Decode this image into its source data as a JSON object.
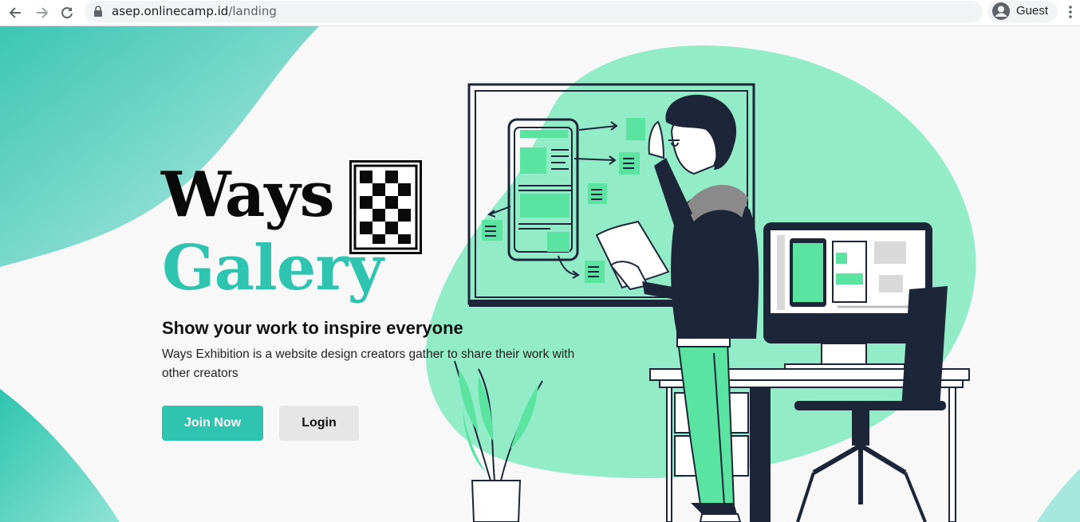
{
  "browser": {
    "url_host": "asep.onlinecamp.id",
    "url_path": "/landing",
    "profile_label": "Guest"
  },
  "hero": {
    "title_line1": "Ways",
    "title_line2": "Galery",
    "tagline": "Show your work to inspire everyone",
    "description": "Ways Exhibition is a website design creators gather to share their work with other creators",
    "join_label": "Join Now",
    "login_label": "Login"
  },
  "colors": {
    "accent": "#2ec4b0",
    "blob_green": "#93ecc8",
    "dark": "#1c2638",
    "bright_green": "#5ae3a1"
  }
}
